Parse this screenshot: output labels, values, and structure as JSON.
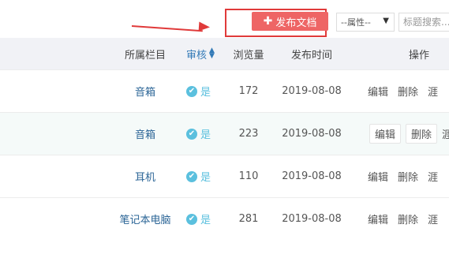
{
  "toolbar": {
    "publish_label": "发布文档",
    "attribute_select": "--属性--",
    "search_placeholder": "标题搜索..."
  },
  "table": {
    "headers": {
      "category": "所属栏目",
      "audit": "审核",
      "views": "浏览量",
      "date": "发布时间",
      "operations": "操作"
    },
    "rows": [
      {
        "category": "音箱",
        "audit": "是",
        "views": "172",
        "date": "2019-08-08",
        "edit": "编辑",
        "delete": "删除",
        "extra": "涯"
      },
      {
        "category": "音箱",
        "audit": "是",
        "views": "223",
        "date": "2019-08-08",
        "edit": "编辑",
        "delete": "删除",
        "extra": "涯"
      },
      {
        "category": "耳机",
        "audit": "是",
        "views": "110",
        "date": "2019-08-08",
        "edit": "编辑",
        "delete": "删除",
        "extra": "涯"
      },
      {
        "category": "笔记本电脑",
        "audit": "是",
        "views": "281",
        "date": "2019-08-08",
        "edit": "编辑",
        "delete": "删除",
        "extra": "涯"
      }
    ]
  },
  "colors": {
    "publish_button": "#ee6565",
    "annotation_red": "#e03a3a",
    "audit_check": "#5bc0de",
    "header_bg": "#f1f2f6",
    "hover_row_bg": "#f5faf9"
  }
}
